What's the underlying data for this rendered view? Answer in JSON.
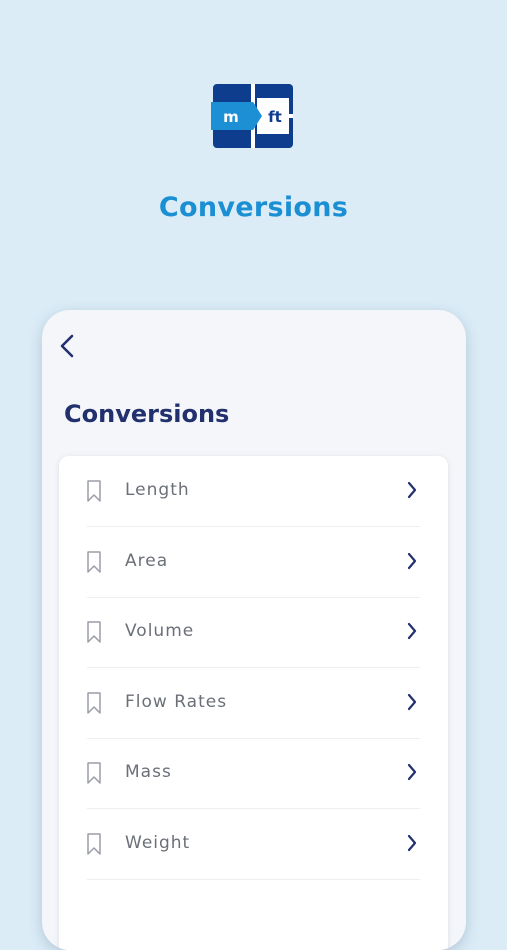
{
  "app": {
    "logo": {
      "left_text": "m",
      "right_text": "ft",
      "icon": "metric-to-feet-logo"
    },
    "promo_title": "Conversions"
  },
  "screen": {
    "back_icon": "chevron-left-icon",
    "title": "Conversions",
    "items": [
      {
        "label": "Length",
        "icon": "bookmark-icon",
        "trailing_icon": "chevron-right-icon"
      },
      {
        "label": "Area",
        "icon": "bookmark-icon",
        "trailing_icon": "chevron-right-icon"
      },
      {
        "label": "Volume",
        "icon": "bookmark-icon",
        "trailing_icon": "chevron-right-icon"
      },
      {
        "label": "Flow Rates",
        "icon": "bookmark-icon",
        "trailing_icon": "chevron-right-icon"
      },
      {
        "label": "Mass",
        "icon": "bookmark-icon",
        "trailing_icon": "chevron-right-icon"
      },
      {
        "label": "Weight",
        "icon": "bookmark-icon",
        "trailing_icon": "chevron-right-icon"
      }
    ]
  },
  "colors": {
    "background": "#dbecf7",
    "promo_title": "#1b8fd3",
    "screen_title": "#22306e",
    "chevron": "#22306e",
    "logo_dark": "#0e3d8e",
    "logo_light": "#1d8fd5"
  }
}
